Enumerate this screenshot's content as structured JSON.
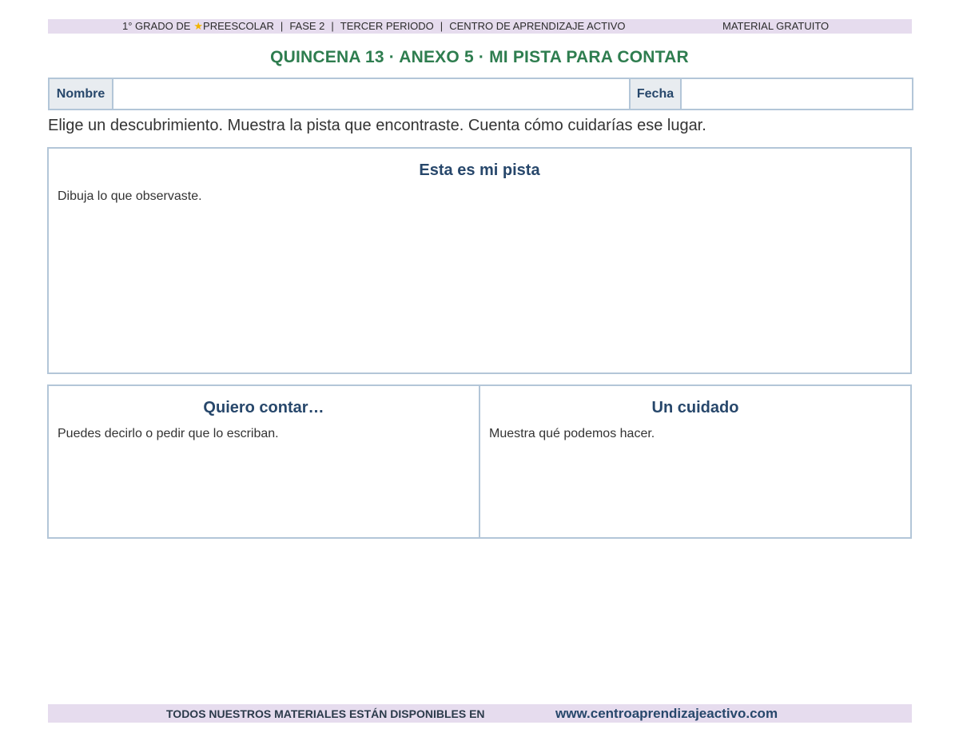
{
  "header_banner": {
    "prefix": "1° GRADO DE",
    "star_icon": "star-icon",
    "level": "PREESCOLAR",
    "phase": "FASE 2",
    "period": "TERCER PERIODO",
    "center": "CENTRO DE APRENDIZAJE ACTIVO",
    "separator": "|",
    "right_label": "MATERIAL GRATUITO"
  },
  "title": "QUINCENA 13 · ANEXO 5 · MI PISTA PARA CONTAR",
  "form": {
    "name_label": "Nombre",
    "name_value": "",
    "date_label": "Fecha",
    "date_value": ""
  },
  "instructions": "Elige un descubrimiento. Muestra la pista que encontraste. Cuenta cómo cuidarías ese lugar.",
  "sections": {
    "pista": {
      "heading": "Esta es mi pista",
      "hint": "Dibuja lo que observaste."
    },
    "contar": {
      "heading": "Quiero contar…",
      "hint": "Puedes decirlo o pedir que lo escriban."
    },
    "cuidado": {
      "heading": "Un cuidado",
      "hint": "Muestra qué podemos hacer."
    }
  },
  "footer_banner": {
    "text": "TODOS NUESTROS MATERIALES ESTÁN DISPONIBLES EN",
    "url": "www.centroaprendizajeactivo.com"
  },
  "colors": {
    "title_green": "#2e7d4f",
    "heading_blue": "#27476b",
    "banner_lilac": "#e6dcee",
    "border_blue": "#b3c6d8",
    "star_yellow": "#f2b400"
  }
}
